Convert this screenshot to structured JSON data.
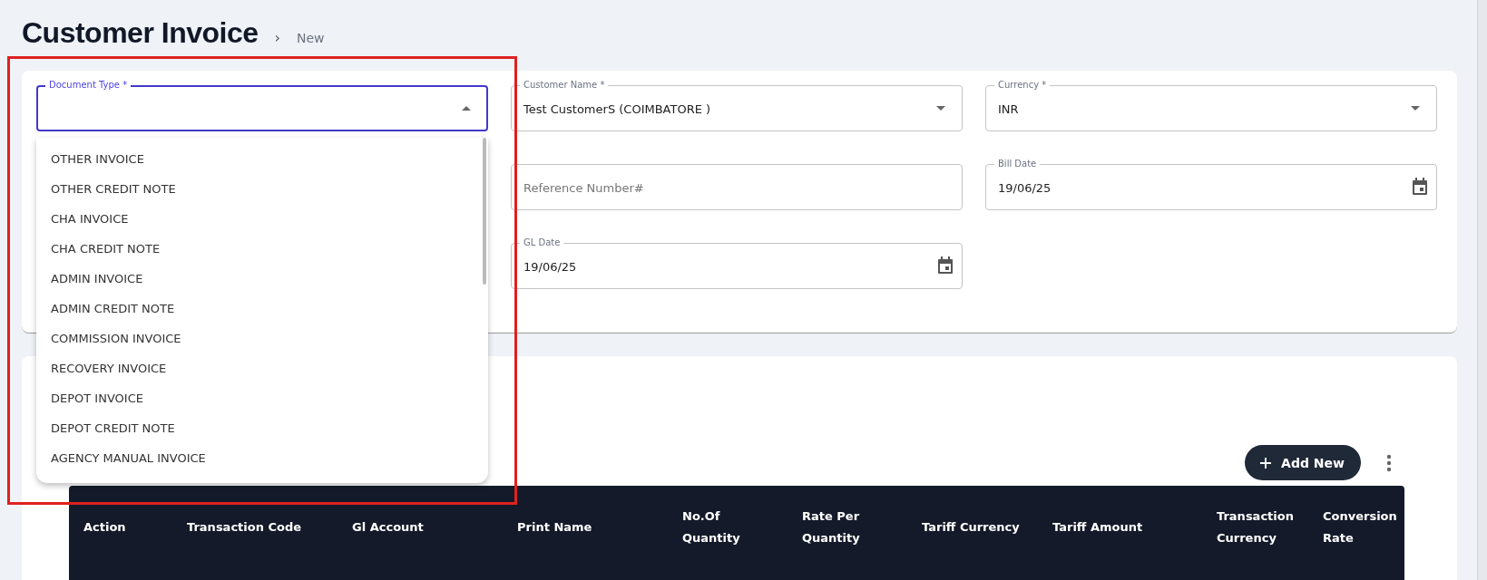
{
  "page": {
    "title": "Customer Invoice",
    "breadcrumb_separator": "›",
    "breadcrumb": "New"
  },
  "form": {
    "columns": [
      {
        "fields": [
          {
            "label": "Document Type *",
            "kind": "select",
            "focused": true,
            "expanded": true
          }
        ]
      },
      {
        "fields": [
          {
            "label": "Customer Name *",
            "value": "Test CustomerS (COIMBATORE )",
            "kind": "select",
            "focused": false,
            "expanded": false
          },
          {
            "placeholder": "Reference Number#",
            "kind": "text",
            "focused": false
          },
          {
            "label": "GL Date",
            "value": "19/06/25",
            "kind": "date",
            "focused": false
          }
        ]
      },
      {
        "fields": [
          {
            "label": "Currency *",
            "value": "INR",
            "kind": "select",
            "focused": false,
            "expanded": false
          },
          {
            "label": "Bill Date",
            "value": "19/06/25",
            "kind": "date",
            "focused": false
          }
        ]
      }
    ]
  },
  "dropdown": {
    "options": [
      {
        "label": "OTHER INVOICE",
        "selected": false
      },
      {
        "label": "OTHER CREDIT NOTE",
        "selected": false
      },
      {
        "label": "CHA INVOICE",
        "selected": false
      },
      {
        "label": "CHA CREDIT NOTE",
        "selected": false
      },
      {
        "label": "ADMIN INVOICE",
        "selected": false
      },
      {
        "label": "ADMIN CREDIT NOTE",
        "selected": false
      },
      {
        "label": "COMMISSION INVOICE",
        "selected": false
      },
      {
        "label": "RECOVERY INVOICE",
        "selected": false
      },
      {
        "label": "DEPOT INVOICE",
        "selected": false
      },
      {
        "label": "DEPOT CREDIT NOTE",
        "selected": false
      },
      {
        "label": "AGENCY MANUAL INVOICE",
        "selected": false
      }
    ]
  },
  "toolbar": {
    "add_button": "Add New"
  },
  "table": {
    "columns": [
      "Action",
      "Transaction Code",
      "Gl Account",
      "Print Name",
      "No.Of Quantity",
      "Rate Per Quantity",
      "Tariff Currency",
      "Tariff Amount",
      "Transaction Currency",
      "Conversion Rate"
    ]
  }
}
